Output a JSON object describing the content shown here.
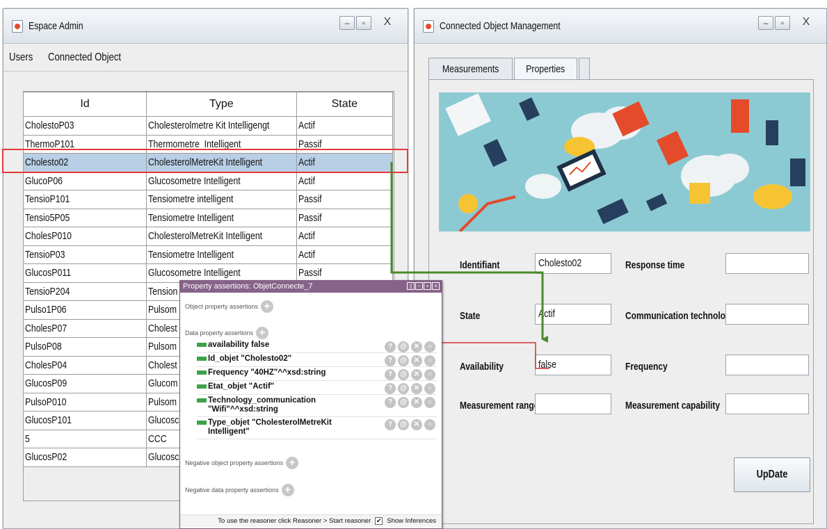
{
  "admin_window": {
    "title": "Espace Admin",
    "menu": [
      "Users",
      "Connected Object"
    ],
    "table": {
      "columns": [
        "Id",
        "Type",
        "State"
      ],
      "rows": [
        [
          "CholestoP03",
          "Cholesterolmetre Kit Intelligengt",
          "Actif"
        ],
        [
          "ThermoP101",
          "Thermometre_Intelligent",
          "Passif"
        ],
        [
          "Cholesto02",
          "CholesterolMetreKit Intelligent",
          "Actif"
        ],
        [
          "GlucoP06",
          "Glucosometre Intelligent",
          "Actif"
        ],
        [
          "TensioP101",
          "Tensiometre intelligent",
          "Passif"
        ],
        [
          "Tensio5P05",
          "Tensiometre Intelligent",
          "Passif"
        ],
        [
          "CholesP010",
          "CholesterolMetreKit Intelligent",
          "Actif"
        ],
        [
          "TensioP03",
          "Tensiometre Intelligent",
          "Actif"
        ],
        [
          "GlucosP011",
          "Glucosometre Intelligent",
          "Passif"
        ],
        [
          "TensioP204",
          "Tension",
          ""
        ],
        [
          "Pulso1P06",
          "Pulsom",
          ""
        ],
        [
          "CholesP07",
          "Cholest",
          ""
        ],
        [
          "PulsoP08",
          "Pulsom",
          ""
        ],
        [
          "CholesP04",
          "Cholest",
          ""
        ],
        [
          "GlucosP09",
          "Glucom",
          ""
        ],
        [
          "PulsoP010",
          "Pulsom",
          ""
        ],
        [
          "GlucosP101",
          "Glucosc",
          ""
        ],
        [
          "5",
          "CCC",
          ""
        ],
        [
          "GlucosP02",
          "Glucosc",
          ""
        ]
      ],
      "selected_row": 2
    }
  },
  "com_window": {
    "title": "Connected Object Management",
    "tabs": [
      "Measurements",
      "Properties"
    ],
    "active_tab": "Properties",
    "fields": {
      "identifiant": {
        "label": "Identifiant",
        "value": "Cholesto02"
      },
      "response_time": {
        "label": "Response time",
        "value": ""
      },
      "state": {
        "label": "State",
        "value": "Actif"
      },
      "communication_technology": {
        "label": "Communication technology",
        "value": ""
      },
      "availability": {
        "label": "Availability",
        "value": "false"
      },
      "frequency": {
        "label": "Frequency",
        "value": ""
      },
      "measurement_range": {
        "label": "Measurement range",
        "value": ""
      },
      "measurement_capability": {
        "label": "Measurement capability",
        "value": ""
      }
    },
    "update_button": "UpDate"
  },
  "property_popup": {
    "title": "Property assertions: ObjetConnecte_7",
    "object_section": "Object property assertions",
    "data_section": "Data property assertions",
    "assertions": [
      "availability  false",
      "Id_objet  \"Cholesto02\"",
      "Frequency  \"40HZ\"^^xsd:string",
      "Etat_objet  \"Actif\"",
      "Technology_communication\n\"Wifi\"^^xsd:string",
      "Type_objet  \"CholesterolMetreKit\nIntelligent\""
    ],
    "negative_object_section": "Negative object property assertions",
    "negative_data_section": "Negative data property assertions",
    "footer_text": "To use the reasoner click Reasoner > Start reasoner",
    "show_inferences_label": "Show Inferences",
    "show_inferences_checked": true
  },
  "colors": {
    "selection": "#b8cfe5",
    "highlight": "#e53935",
    "arrow": "#4a8a2a",
    "popup_title": "#87638a",
    "assertion_bar": "#3ea14a"
  }
}
